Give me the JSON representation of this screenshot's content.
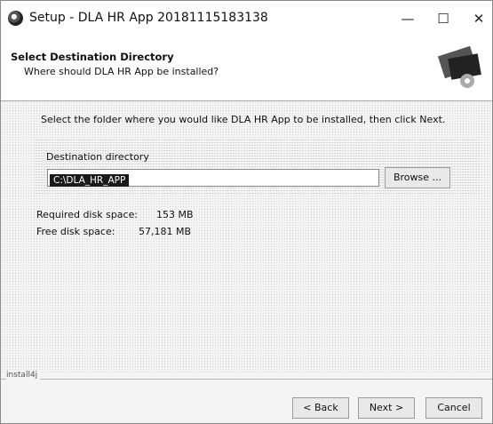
{
  "window": {
    "title": "Setup - DLA HR App 20181115183138",
    "minimize": "—",
    "maximize": "☐",
    "close": "✕"
  },
  "header": {
    "title": "Select Destination Directory",
    "subtitle": "Where should DLA HR App be installed?"
  },
  "body": {
    "intro": "Select the folder where you would like DLA HR App to be installed, then click Next.",
    "destination_label": "Destination directory",
    "destination_value": "C:\\DLA_HR_APP",
    "browse_label": "Browse ...",
    "required_label": "Required disk space:",
    "required_value": "153 MB",
    "free_label": "Free disk space:",
    "free_value": "57,181 MB"
  },
  "footer": {
    "brand": "install4j",
    "back_label": "< Back",
    "next_label": "Next >",
    "cancel_label": "Cancel"
  }
}
